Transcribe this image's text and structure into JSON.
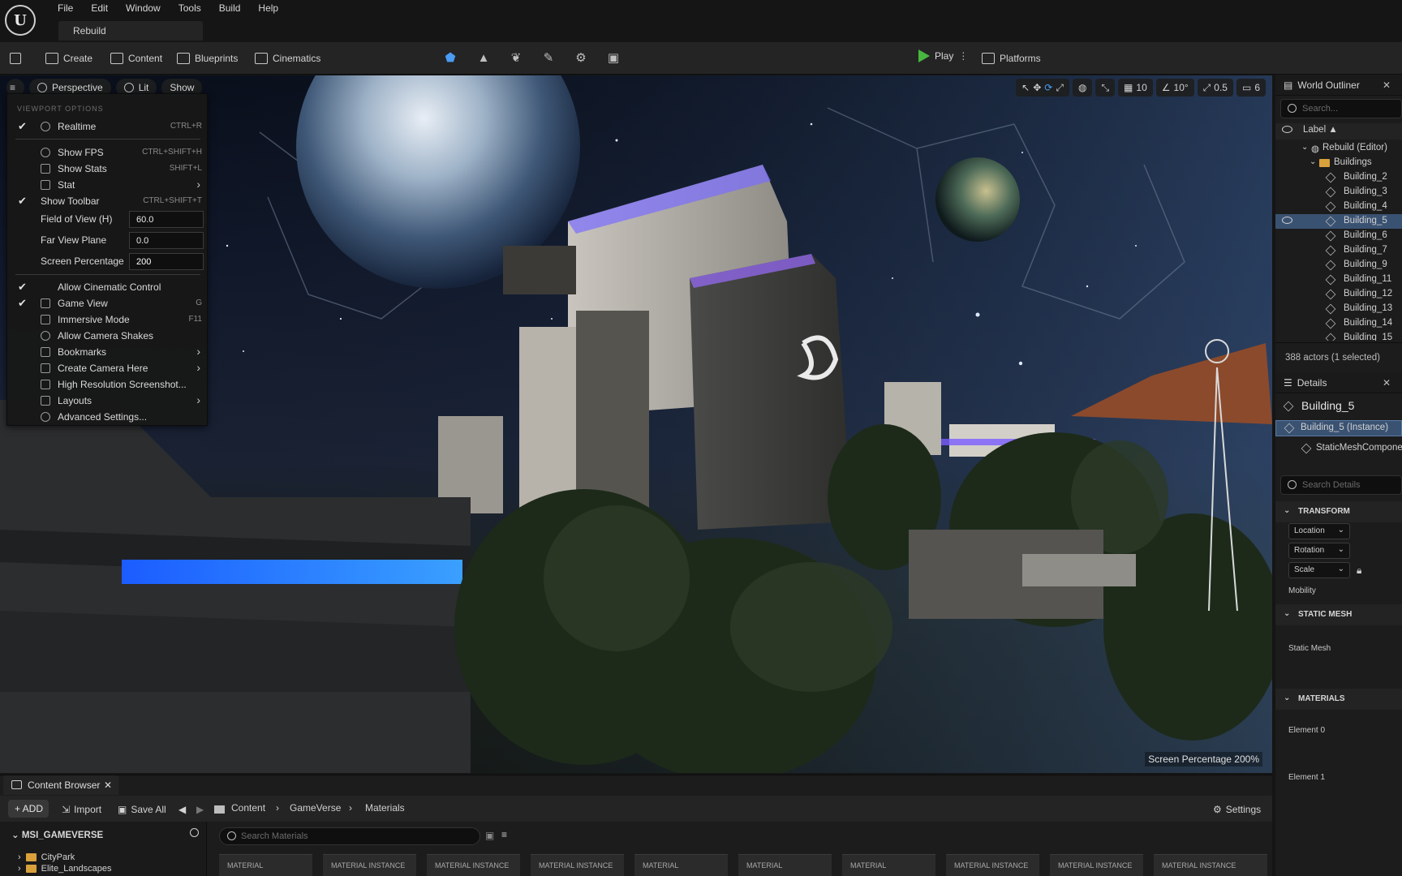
{
  "menubar": {
    "logo": "U",
    "items": [
      "File",
      "Edit",
      "Window",
      "Tools",
      "Build",
      "Help"
    ],
    "project_tab": "Rebuild"
  },
  "toolbar": {
    "create": "Create",
    "content": "Content",
    "blueprints": "Blueprints",
    "cinematics": "Cinematics",
    "play": "Play",
    "platforms": "Platforms"
  },
  "viewport": {
    "perspective": "Perspective",
    "lit": "Lit",
    "show": "Show",
    "grid_snap": "10",
    "rot_snap": "10°",
    "scale_snap": "0.5",
    "cam_speed": "6",
    "screen_percentage_overlay": "Screen Percentage  200%"
  },
  "viewport_menu": {
    "header": "VIEWPORT OPTIONS",
    "realtime": "Realtime",
    "realtime_sc": "CTRL+R",
    "show_fps": "Show FPS",
    "show_fps_sc": "CTRL+SHIFT+H",
    "show_stats": "Show Stats",
    "show_stats_sc": "SHIFT+L",
    "stat": "Stat",
    "show_toolbar": "Show Toolbar",
    "show_toolbar_sc": "CTRL+SHIFT+T",
    "fov_label": "Field of View (H)",
    "fov_value": "60.0",
    "far_label": "Far View Plane",
    "far_value": "0.0",
    "sp_label": "Screen Percentage",
    "sp_value": "200",
    "allow_cinematic": "Allow Cinematic Control",
    "game_view": "Game View",
    "game_view_sc": "G",
    "immersive": "Immersive Mode",
    "immersive_sc": "F11",
    "camera_shakes": "Allow Camera Shakes",
    "bookmarks": "Bookmarks",
    "create_camera": "Create Camera Here",
    "hires": "High Resolution Screenshot...",
    "layouts": "Layouts",
    "advanced": "Advanced Settings..."
  },
  "outliner": {
    "title": "World Outliner",
    "search_placeholder": "Search...",
    "label_col": "Label ▲",
    "root": "Rebuild (Editor)",
    "folder": "Buildings",
    "items": [
      "Building_2",
      "Building_3",
      "Building_4",
      "Building_5",
      "Building_6",
      "Building_7",
      "Building_9",
      "Building_11",
      "Building_12",
      "Building_13",
      "Building_14",
      "Building_15"
    ],
    "selected": "Building_5",
    "count": "388 actors (1 selected)"
  },
  "details": {
    "title": "Details",
    "object": "Building_5",
    "instance": "Building_5 (Instance)",
    "component": "StaticMeshComponent",
    "search_placeholder": "Search Details",
    "transform": "TRANSFORM",
    "location": "Location",
    "rotation": "Rotation",
    "scale": "Scale",
    "mobility": "Mobility",
    "static_mesh_hdr": "STATIC MESH",
    "static_mesh": "Static Mesh",
    "materials_hdr": "MATERIALS",
    "element0": "Element 0",
    "element1": "Element 1"
  },
  "content_browser": {
    "tab": "Content Browser",
    "add": "+ ADD",
    "import": "Import",
    "save_all": "Save All",
    "crumbs": [
      "Content",
      "GameVerse",
      "Materials"
    ],
    "settings": "Settings",
    "root": "MSI_GAMEVERSE",
    "folders": [
      "CityPark",
      "Elite_Landscapes"
    ],
    "search_placeholder": "Search Materials",
    "assets": [
      "MATERIAL",
      "MATERIAL INSTANCE",
      "MATERIAL INSTANCE",
      "MATERIAL INSTANCE",
      "MATERIAL",
      "MATERIAL",
      "MATERIAL",
      "MATERIAL INSTANCE",
      "MATERIAL INSTANCE",
      "MATERIAL INSTANCE"
    ]
  },
  "colors": {
    "accent": "#3a5272",
    "play_green": "#47b73f",
    "folder": "#d9a13b",
    "neon_blue": "#2c6cff"
  }
}
